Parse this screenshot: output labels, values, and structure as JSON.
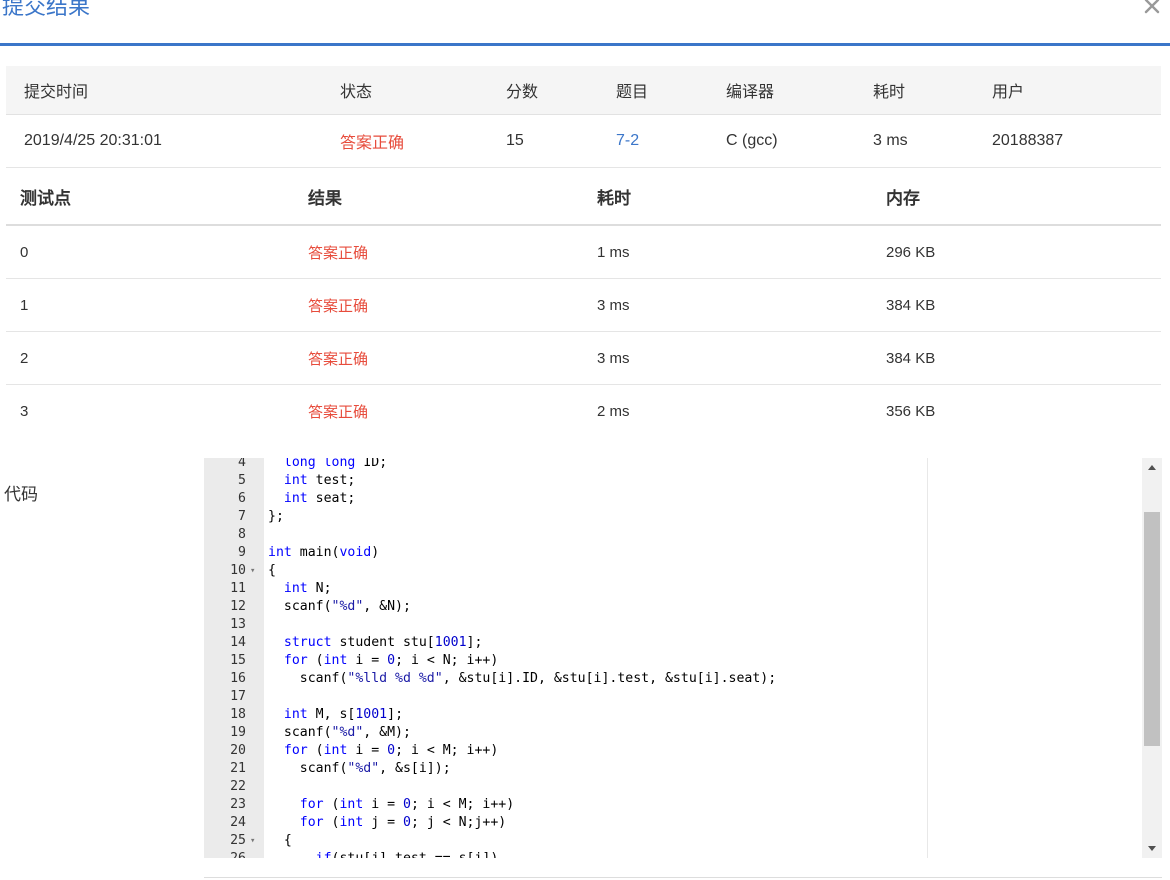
{
  "dialog": {
    "title": "提交结果",
    "close_icon": "close-icon"
  },
  "summary": {
    "headers": [
      "提交时间",
      "状态",
      "分数",
      "题目",
      "编译器",
      "耗时",
      "用户"
    ],
    "row": {
      "time": "2019/4/25 20:31:01",
      "status": "答案正确",
      "score": "15",
      "problem": "7-2",
      "compiler": "C (gcc)",
      "elapsed": "3 ms",
      "user": "20188387"
    }
  },
  "tests": {
    "headers": [
      "测试点",
      "结果",
      "耗时",
      "内存"
    ],
    "rows": [
      {
        "id": "0",
        "result": "答案正确",
        "time": "1 ms",
        "memory": "296 KB"
      },
      {
        "id": "1",
        "result": "答案正确",
        "time": "3 ms",
        "memory": "384 KB"
      },
      {
        "id": "2",
        "result": "答案正确",
        "time": "3 ms",
        "memory": "384 KB"
      },
      {
        "id": "3",
        "result": "答案正确",
        "time": "2 ms",
        "memory": "356 KB"
      }
    ]
  },
  "code": {
    "label": "代码",
    "lines": [
      {
        "n": "4",
        "text": "  long long ID;"
      },
      {
        "n": "5",
        "text": "  int test;"
      },
      {
        "n": "6",
        "text": "  int seat;"
      },
      {
        "n": "7",
        "text": "};"
      },
      {
        "n": "8",
        "text": ""
      },
      {
        "n": "9",
        "text": "int main(void)"
      },
      {
        "n": "10",
        "text": "{",
        "fold": true
      },
      {
        "n": "11",
        "text": "  int N;"
      },
      {
        "n": "12",
        "text": "  scanf(\"%d\", &N);"
      },
      {
        "n": "13",
        "text": ""
      },
      {
        "n": "14",
        "text": "  struct student stu[1001];"
      },
      {
        "n": "15",
        "text": "  for (int i = 0; i < N; i++)"
      },
      {
        "n": "16",
        "text": "    scanf(\"%lld %d %d\", &stu[i].ID, &stu[i].test, &stu[i].seat);"
      },
      {
        "n": "17",
        "text": ""
      },
      {
        "n": "18",
        "text": "  int M, s[1001];"
      },
      {
        "n": "19",
        "text": "  scanf(\"%d\", &M);"
      },
      {
        "n": "20",
        "text": "  for (int i = 0; i < M; i++)"
      },
      {
        "n": "21",
        "text": "    scanf(\"%d\", &s[i]);"
      },
      {
        "n": "22",
        "text": ""
      },
      {
        "n": "23",
        "text": "    for (int i = 0; i < M; i++)"
      },
      {
        "n": "24",
        "text": "    for (int j = 0; j < N;j++)"
      },
      {
        "n": "25",
        "text": "  {",
        "fold": true
      },
      {
        "n": "26",
        "text": "      if(stu[j].test == s[i])"
      }
    ]
  },
  "colors": {
    "accent": "#3b76c9",
    "accepted": "#e74c3c"
  }
}
